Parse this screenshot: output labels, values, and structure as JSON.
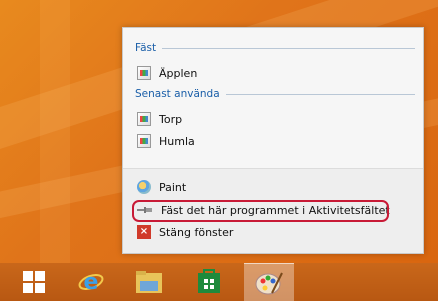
{
  "jumplist": {
    "pinned_header": "Fäst",
    "pinned_items": [
      {
        "label": "Äpplen",
        "icon": "image-file-icon"
      }
    ],
    "recent_header": "Senast använda",
    "recent_items": [
      {
        "label": "Torp",
        "icon": "image-file-icon"
      },
      {
        "label": "Humla",
        "icon": "image-file-icon"
      }
    ],
    "tasks": {
      "app_label": "Paint",
      "pin_label": "Fäst det här programmet i Aktivitetsfältet",
      "close_label": "Stäng fönster"
    }
  },
  "taskbar": {
    "items": [
      "start-button",
      "internet-explorer",
      "file-explorer",
      "windows-store",
      "paint"
    ]
  },
  "colors": {
    "highlight": "#c81a36",
    "header": "#1a5ea8",
    "desktop": "#e07a14"
  }
}
